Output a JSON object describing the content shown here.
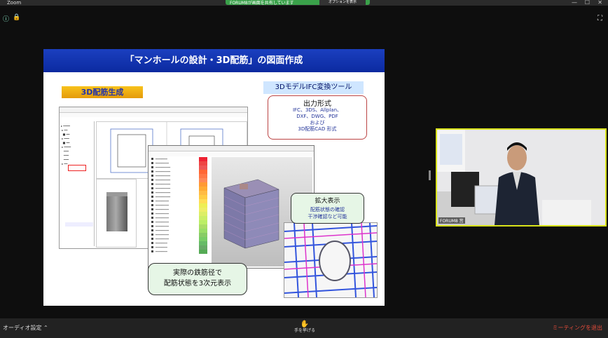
{
  "window": {
    "app_name": "Zoom",
    "share_banner_text": "FORUM8が画面を共有しています",
    "stop_share_label": "オプションを表示"
  },
  "slide": {
    "title": "「マンホールの設計・3D配筋」の図面作成",
    "badge": "3D配筋生成",
    "ifc_title": "3DモデルIFC変換ツール",
    "output_heading": "出力形式",
    "output_lines": "IFC、3DS、Allplan、\nDXF、DWG、PDF\nおよび\n3D配筋CAD 形式",
    "zoom_callout_heading": "拡大表示",
    "zoom_callout_line1": "配筋状態の確認",
    "zoom_callout_line2": "干渉確認など可能",
    "real_callout_line1": "実際の鉄筋径で",
    "real_callout_line2": "配筋状態を3次元表示"
  },
  "video": {
    "participant_label": "FORUM8 営"
  },
  "toolbar": {
    "audio_label": "オーディオ設定",
    "raise_hand_label": "手を挙げる",
    "leave_label": "ミーティングを退出"
  },
  "colors": {
    "accent_green": "#3aa14a",
    "speaker_border": "#d9e31a",
    "leave_red": "#e04b3a"
  }
}
